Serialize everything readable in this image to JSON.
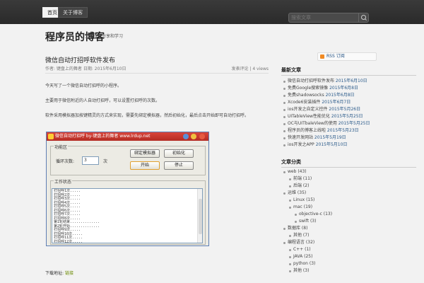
{
  "nav": {
    "tabs": [
      "首页",
      "关于博客"
    ],
    "search_placeholder": "搜索文章"
  },
  "site": {
    "title": "程序员的博客",
    "description": "生活在于分享和学习"
  },
  "post": {
    "title": "微信自动打招呼软件发布",
    "meta_left": "作者: 键盘上的舞者 日期: 2015年6月10日",
    "meta_right": "发表评论 | 4 views",
    "p1": "今天写了一个微信自动打招呼的小程序。",
    "p2": "主要用于微信附近的人自动打招呼，可以设置打招呼的次数。",
    "p3": "软件采用模拟器加按键精灵的方式来实现，需要先绑定模拟器，然后初始化，最后点击开始即可自动打招呼。",
    "download_label": "下载地址:",
    "download_link": "链接"
  },
  "app_window": {
    "title": "微信自动打招呼  by-键盘上的舞者  www.lrdup.net",
    "function_group": "功能区",
    "loop_label": "循环次数:",
    "loop_value": "3",
    "loop_unit": "次",
    "bind_button": "绑定模拟器",
    "init_button": "初始化",
    "start_button": "开始",
    "stop_button": "停止",
    "status_group": "工作状态",
    "log_lines": [
      "打招呼1次.....",
      "打招呼2次.....",
      "打招呼3次.....",
      "打招呼4次.....",
      "打招呼5次.....",
      "打招呼6次.....",
      "打招呼7次.....",
      "打招呼8次.....",
      "第1轮结束..............",
      "第2轮开始..............",
      "打招呼9次.....",
      "打招呼10次.....",
      "打招呼11次.....",
      "打招呼12次....."
    ]
  },
  "sidebar": {
    "rss_label": "RSS 订阅",
    "recent_title": "最新文章",
    "recent_posts": [
      {
        "title": "微信自动打招呼软件发布",
        "date": "2015年6月10日"
      },
      {
        "title": "免费Google搜索镜像",
        "date": "2015年6月8日"
      },
      {
        "title": "免费shadowsocks",
        "date": "2015年6月8日"
      },
      {
        "title": "Xcode6安装插件",
        "date": "2015年6月7日"
      },
      {
        "title": "ios开发之自定义控件",
        "date": "2015年5月26日"
      },
      {
        "title": "UITableView性能优化",
        "date": "2015年5月25日"
      },
      {
        "title": "OC与UITbaleView的使用",
        "date": "2015年5月25日"
      },
      {
        "title": "程序员的博客上线啦",
        "date": "2015年5月23日"
      },
      {
        "title": "快速开发网站",
        "date": "2015年5月19日"
      },
      {
        "title": "ios开发之APP",
        "date": "2015年5月10日"
      }
    ],
    "category_title": "文章分类",
    "categories": [
      {
        "label": "web (43)",
        "level": 0
      },
      {
        "label": "前端 (11)",
        "level": 1
      },
      {
        "label": "后端 (2)",
        "level": 1
      },
      {
        "label": "运维 (35)",
        "level": 0
      },
      {
        "label": "Linux (15)",
        "level": 1
      },
      {
        "label": "mac (19)",
        "level": 1
      },
      {
        "label": "objective-c (13)",
        "level": 2
      },
      {
        "label": "swift (3)",
        "level": 2
      },
      {
        "label": "数据库 (8)",
        "level": 0
      },
      {
        "label": "其他 (7)",
        "level": 1
      },
      {
        "label": "编程语言 (32)",
        "level": 0
      },
      {
        "label": "C++ (1)",
        "level": 1
      },
      {
        "label": "JAVA (25)",
        "level": 1
      },
      {
        "label": "python (3)",
        "level": 1
      },
      {
        "label": "其他 (3)",
        "level": 1
      }
    ]
  }
}
